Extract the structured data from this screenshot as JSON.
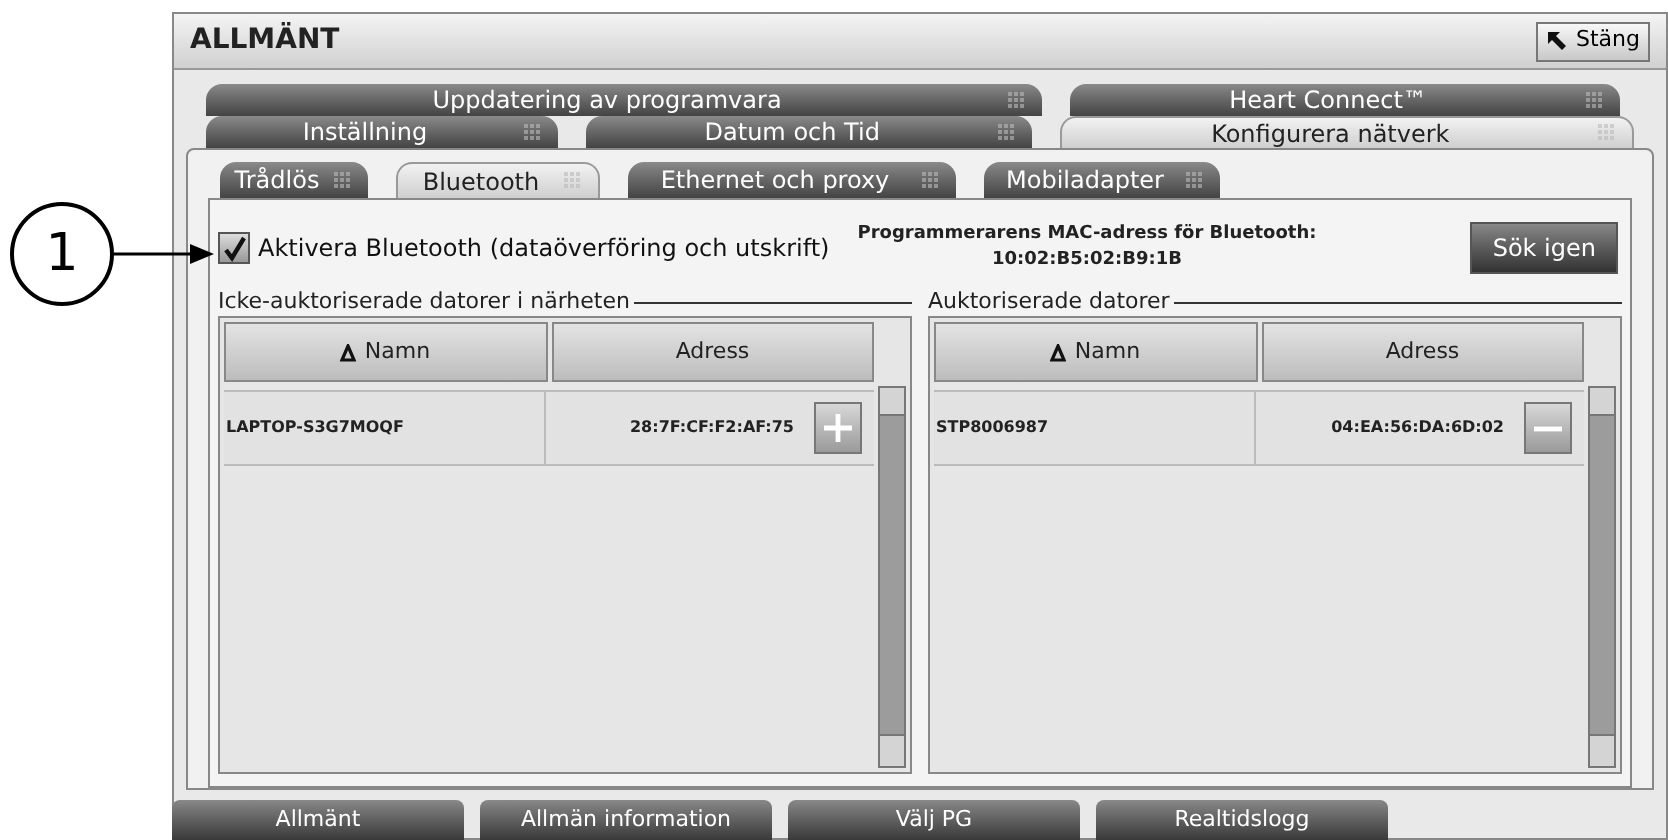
{
  "callout": {
    "label": "1"
  },
  "window": {
    "title": "ALLMÄNT",
    "close_button": "Stäng"
  },
  "tab_rows": [
    [
      {
        "label": "Uppdatering av programvara",
        "selected": false
      },
      {
        "label": "Heart Connect™",
        "selected": false
      }
    ],
    [
      {
        "label": "Inställning",
        "selected": false
      },
      {
        "label": "Datum och Tid",
        "selected": false
      },
      {
        "label": "Konfigurera nätverk",
        "selected": true
      }
    ]
  ],
  "subtabs": [
    {
      "label": "Trådlös",
      "selected": false
    },
    {
      "label": "Bluetooth",
      "selected": true
    },
    {
      "label": "Ethernet och proxy",
      "selected": false
    },
    {
      "label": "Mobiladapter",
      "selected": false
    }
  ],
  "bluetooth": {
    "enable": {
      "label": "Aktivera Bluetooth (dataöverföring och utskrift)",
      "checked": true
    },
    "mac_label": "Programmerarens MAC-adress för Bluetooth:",
    "mac_address": "10:02:B5:02:B9:1B",
    "rescan_button": "Sök igen"
  },
  "tables": [
    {
      "title": "Icke-auktoriserade datorer i närheten",
      "columns": [
        "Namn",
        "Adress"
      ],
      "rows": [
        {
          "name": "LAPTOP-S3G7MOQF",
          "address": "28:7F:CF:F2:AF:75",
          "kind": "add"
        }
      ]
    },
    {
      "title": "Auktoriserade datorer",
      "columns": [
        "Namn",
        "Adress"
      ],
      "rows": [
        {
          "name": "STP8006987",
          "address": "04:EA:56:DA:6D:02",
          "kind": "remove"
        }
      ]
    }
  ],
  "bottom_tabs": [
    "Allmänt",
    "Allmän information",
    "Välj PG",
    "Realtidslogg"
  ]
}
